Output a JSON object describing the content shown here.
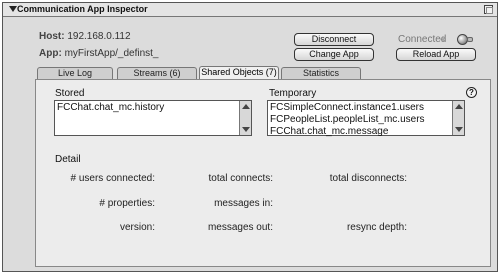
{
  "window": {
    "title": "Communication App Inspector"
  },
  "host": {
    "label": "Host:",
    "value": "192.168.0.112"
  },
  "app": {
    "label": "App:",
    "value": "myFirstApp/_definst_"
  },
  "buttons": {
    "disconnect": "Disconnect",
    "change_app": "Change App",
    "reload_app": "Reload App"
  },
  "status": {
    "text": "Connected",
    "indicator_color": "#8a8a8a"
  },
  "tabs": [
    {
      "label": "Live Log",
      "active": false
    },
    {
      "label": "Streams (6)",
      "active": false
    },
    {
      "label": "Shared Objects (7)",
      "active": true
    },
    {
      "label": "Statistics",
      "active": false
    }
  ],
  "stored": {
    "label": "Stored",
    "items": [
      "FCChat.chat_mc.history"
    ]
  },
  "temporary": {
    "label": "Temporary",
    "items": [
      "FCSimpleConnect.instance1.users",
      "FCPeopleList.peopleList_mc.users",
      "FCChat.chat_mc.message"
    ]
  },
  "detail": {
    "label": "Detail",
    "fields": {
      "users_connected": "# users connected:",
      "total_connects": "total connects:",
      "total_disconnects": "total disconnects:",
      "properties": "# properties:",
      "messages_in": "messages in:",
      "version": "version:",
      "messages_out": "messages out:",
      "resync_depth": "resync depth:"
    }
  },
  "help_icon": "?"
}
